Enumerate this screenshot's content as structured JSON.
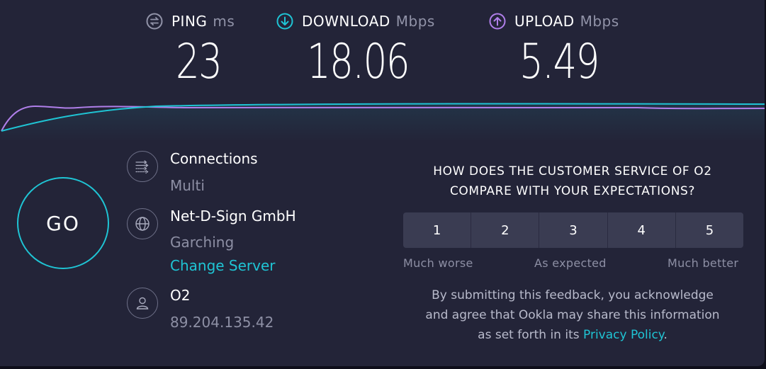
{
  "metrics": {
    "ping": {
      "label": "PING",
      "unit": "ms",
      "value": "23",
      "icon": "ping-icon",
      "color": "#9193a8"
    },
    "download": {
      "label": "DOWNLOAD",
      "unit": "Mbps",
      "value": "18.06",
      "icon": "download-arrow-icon",
      "color": "#1fc4d4"
    },
    "upload": {
      "label": "UPLOAD",
      "unit": "Mbps",
      "value": "5.49",
      "icon": "upload-arrow-icon",
      "color": "#b07fea"
    }
  },
  "go_button": {
    "label": "GO"
  },
  "connections": {
    "title": "Connections",
    "value": "Multi",
    "icon": "connections-icon"
  },
  "server": {
    "name": "Net-D-Sign GmbH",
    "location": "Garching",
    "change_link": "Change Server",
    "icon": "globe-icon"
  },
  "provider": {
    "name": "O2",
    "ip": "89.204.135.42",
    "icon": "user-icon"
  },
  "survey": {
    "question_line1": "HOW DOES THE CUSTOMER SERVICE OF O2",
    "question_line2": "COMPARE WITH YOUR EXPECTATIONS?",
    "ratings": [
      "1",
      "2",
      "3",
      "4",
      "5"
    ],
    "label_low": "Much worse",
    "label_mid": "As expected",
    "label_high": "Much better",
    "disclaimer_line1": "By submitting this feedback, you acknowledge",
    "disclaimer_line2": "and agree that Ookla may share this information",
    "disclaimer_prefix": "as set forth in its ",
    "privacy_link": "Privacy Policy",
    "disclaimer_suffix": "."
  },
  "colors": {
    "background": "#232438",
    "accent": "#1fc4d4",
    "upload": "#b07fea",
    "muted": "#8d8fa4"
  }
}
